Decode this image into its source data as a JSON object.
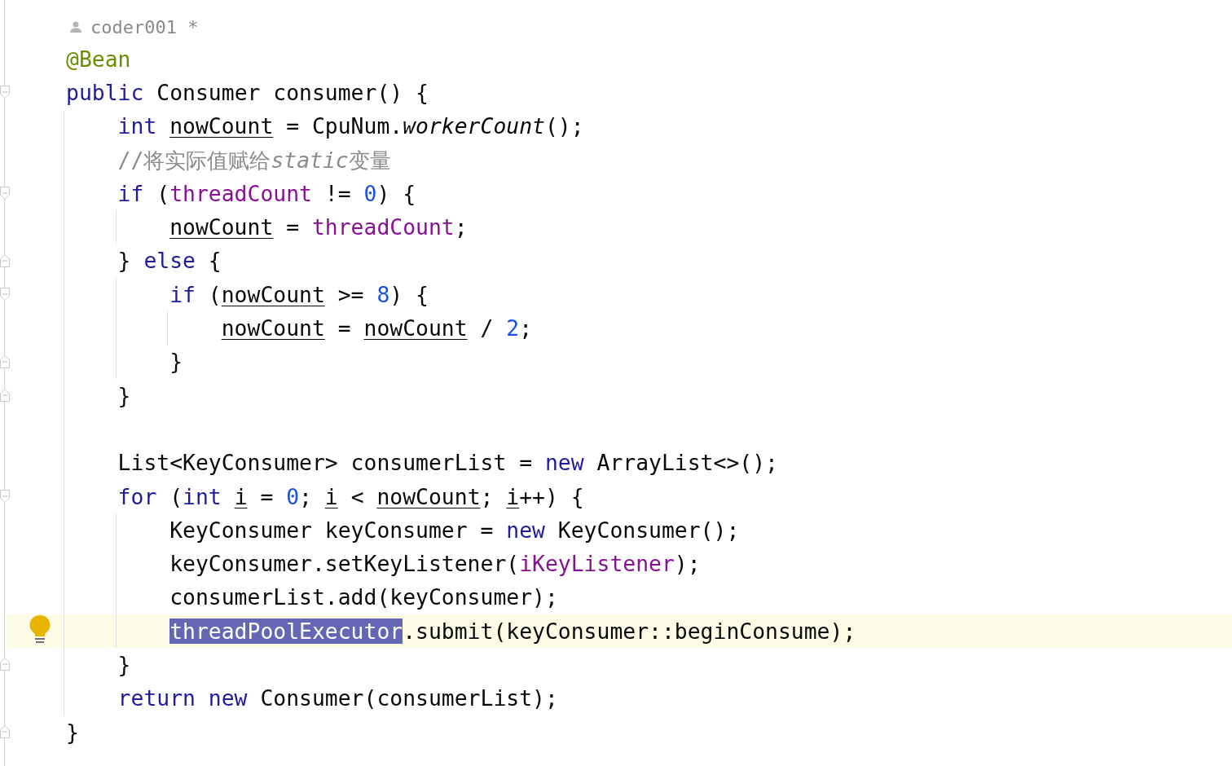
{
  "author": {
    "name": "coder001 *"
  },
  "lines": [
    {
      "kind": "code",
      "tokens": [
        {
          "text": "    @Bean",
          "kind": "ann"
        }
      ]
    },
    {
      "kind": "code",
      "fold": {
        "kind": "open"
      },
      "tokens": [
        {
          "text": "    public",
          "kind": "kw"
        },
        {
          "text": " Consumer consumer() {",
          "kind": "plain"
        }
      ]
    },
    {
      "kind": "code",
      "tokens": [
        {
          "text": "        int ",
          "kind": "kw"
        },
        {
          "text": "nowCount",
          "kind": "var"
        },
        {
          "text": " = CpuNum.",
          "kind": "plain"
        },
        {
          "text": "workerCount",
          "kind": "italic"
        },
        {
          "text": "();",
          "kind": "plain"
        }
      ]
    },
    {
      "kind": "code",
      "tokens": [
        {
          "text": "        //将实际值赋给",
          "kind": "comment"
        },
        {
          "text": "static",
          "kind": "comment-italic"
        },
        {
          "text": "变量",
          "kind": "comment"
        }
      ]
    },
    {
      "kind": "code",
      "fold": {
        "kind": "open"
      },
      "tokens": [
        {
          "text": "        if",
          "kind": "kw"
        },
        {
          "text": " (",
          "kind": "plain"
        },
        {
          "text": "threadCount",
          "kind": "field"
        },
        {
          "text": " != ",
          "kind": "plain"
        },
        {
          "text": "0",
          "kind": "num"
        },
        {
          "text": ") {",
          "kind": "plain"
        }
      ]
    },
    {
      "kind": "code",
      "tokens": [
        {
          "text": "            nowCount",
          "kind": "var"
        },
        {
          "text": " = ",
          "kind": "plain"
        },
        {
          "text": "threadCount",
          "kind": "field"
        },
        {
          "text": ";",
          "kind": "plain"
        }
      ]
    },
    {
      "kind": "code",
      "fold": {
        "kind": "close"
      },
      "tokens": [
        {
          "text": "        } ",
          "kind": "plain"
        },
        {
          "text": "else",
          "kind": "kw"
        },
        {
          "text": " {",
          "kind": "plain"
        }
      ]
    },
    {
      "kind": "code",
      "fold": {
        "kind": "open"
      },
      "tokens": [
        {
          "text": "            if",
          "kind": "kw"
        },
        {
          "text": " (",
          "kind": "plain"
        },
        {
          "text": "nowCount",
          "kind": "var"
        },
        {
          "text": " >= ",
          "kind": "plain"
        },
        {
          "text": "8",
          "kind": "num"
        },
        {
          "text": ") {",
          "kind": "plain"
        }
      ]
    },
    {
      "kind": "code",
      "tokens": [
        {
          "text": "                nowCount",
          "kind": "var"
        },
        {
          "text": " = ",
          "kind": "plain"
        },
        {
          "text": "nowCount",
          "kind": "var"
        },
        {
          "text": " / ",
          "kind": "plain"
        },
        {
          "text": "2",
          "kind": "num"
        },
        {
          "text": ";",
          "kind": "plain"
        }
      ]
    },
    {
      "kind": "code",
      "fold": {
        "kind": "close"
      },
      "tokens": [
        {
          "text": "            }",
          "kind": "plain"
        }
      ]
    },
    {
      "kind": "code",
      "fold": {
        "kind": "close"
      },
      "tokens": [
        {
          "text": "        }",
          "kind": "plain"
        }
      ]
    },
    {
      "kind": "blank"
    },
    {
      "kind": "code",
      "tokens": [
        {
          "text": "        List<KeyConsumer> consumerList = ",
          "kind": "plain"
        },
        {
          "text": "new",
          "kind": "kw"
        },
        {
          "text": " ArrayList<>();",
          "kind": "plain"
        }
      ]
    },
    {
      "kind": "code",
      "fold": {
        "kind": "open"
      },
      "tokens": [
        {
          "text": "        for",
          "kind": "kw"
        },
        {
          "text": " (",
          "kind": "plain"
        },
        {
          "text": "int ",
          "kind": "kw"
        },
        {
          "text": "i",
          "kind": "var"
        },
        {
          "text": " = ",
          "kind": "plain"
        },
        {
          "text": "0",
          "kind": "num"
        },
        {
          "text": "; ",
          "kind": "plain"
        },
        {
          "text": "i",
          "kind": "var"
        },
        {
          "text": " < ",
          "kind": "plain"
        },
        {
          "text": "nowCount",
          "kind": "var"
        },
        {
          "text": "; ",
          "kind": "plain"
        },
        {
          "text": "i",
          "kind": "var"
        },
        {
          "text": "++) {",
          "kind": "plain"
        }
      ]
    },
    {
      "kind": "code",
      "tokens": [
        {
          "text": "            KeyConsumer keyConsumer = ",
          "kind": "plain"
        },
        {
          "text": "new",
          "kind": "kw"
        },
        {
          "text": " KeyConsumer();",
          "kind": "plain"
        }
      ]
    },
    {
      "kind": "code",
      "tokens": [
        {
          "text": "            keyConsumer.setKeyListener(",
          "kind": "plain"
        },
        {
          "text": "iKeyListener",
          "kind": "field"
        },
        {
          "text": ");",
          "kind": "plain"
        }
      ]
    },
    {
      "kind": "code",
      "tokens": [
        {
          "text": "            consumerList.add(keyConsumer);",
          "kind": "plain"
        }
      ]
    },
    {
      "kind": "code",
      "current": true,
      "bulb": true,
      "tokens": [
        {
          "text": "            threadPoolExecutor",
          "kind": "selection"
        },
        {
          "text": ".submit(keyConsumer::beginConsume);",
          "kind": "plain"
        }
      ]
    },
    {
      "kind": "code",
      "fold": {
        "kind": "close"
      },
      "tokens": [
        {
          "text": "        }",
          "kind": "plain"
        }
      ]
    },
    {
      "kind": "code",
      "tokens": [
        {
          "text": "        return new",
          "kind": "kw"
        },
        {
          "text": " Consumer(consumerList);",
          "kind": "plain"
        }
      ]
    },
    {
      "kind": "code",
      "fold": {
        "kind": "close"
      },
      "tokens": [
        {
          "text": "    }",
          "kind": "plain"
        }
      ]
    }
  ]
}
